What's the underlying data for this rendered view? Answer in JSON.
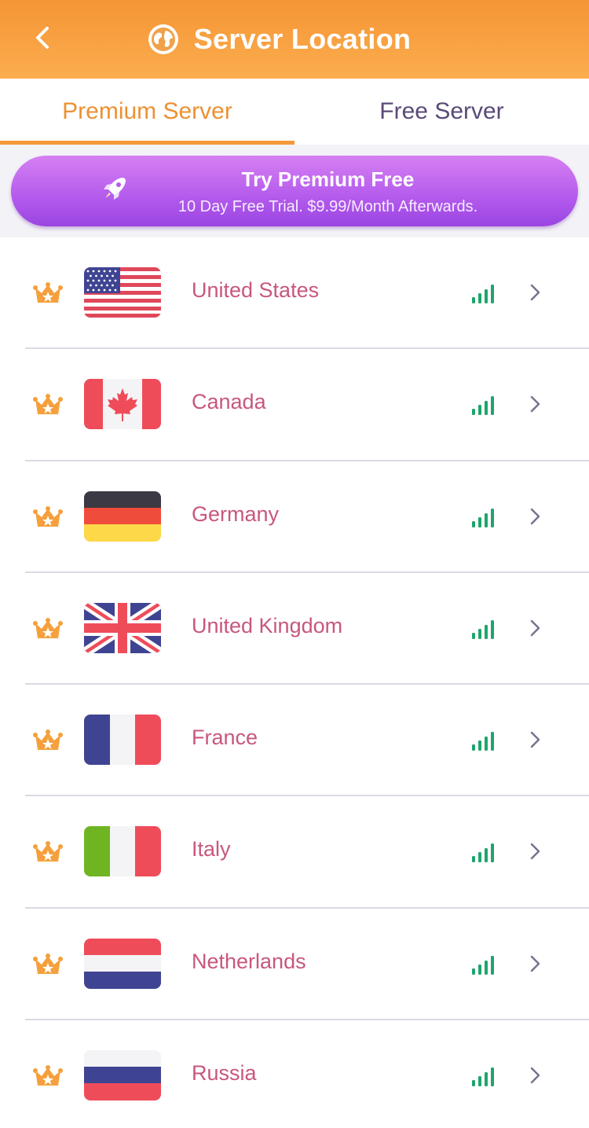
{
  "header": {
    "title": "Server Location",
    "back_icon": "chevron-left-icon",
    "title_icon": "globe-icon",
    "gradient": [
      "#f59535",
      "#fbad4f"
    ]
  },
  "tabs": [
    {
      "label": "Premium Server",
      "active": true
    },
    {
      "label": "Free Server",
      "active": false
    }
  ],
  "promo": {
    "title": "Try Premium Free",
    "subtitle": "10 Day Free Trial. $9.99/Month Afterwards.",
    "icon": "rocket-icon"
  },
  "servers": [
    {
      "name": "United States",
      "flag": "us"
    },
    {
      "name": "Canada",
      "flag": "ca"
    },
    {
      "name": "Germany",
      "flag": "de"
    },
    {
      "name": "United Kingdom",
      "flag": "gb"
    },
    {
      "name": "France",
      "flag": "fr"
    },
    {
      "name": "Italy",
      "flag": "it"
    },
    {
      "name": "Netherlands",
      "flag": "nl"
    },
    {
      "name": "Russia",
      "flag": "ru"
    }
  ],
  "colors": {
    "accent": "#ec9133",
    "country_text": "#c8577d",
    "signal": "#1fa56b",
    "crown": "#f5a03c",
    "promo": "#b65ded"
  }
}
